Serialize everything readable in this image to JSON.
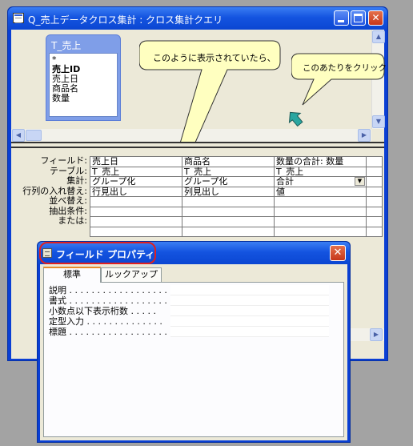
{
  "query_window": {
    "title": "Q_売上データクロス集計 : クロス集計クエリ",
    "table_box": {
      "name": "T_売上",
      "fields": [
        "*",
        "売上ID",
        "売上日",
        "商品名",
        "数量"
      ]
    }
  },
  "grid": {
    "row_labels": [
      "フィールド:",
      "テーブル:",
      "集計:",
      "行列の入れ替え:",
      "並べ替え:",
      "抽出条件:",
      "または:"
    ],
    "columns": [
      {
        "field": "売上日",
        "table": "T_売上",
        "total": "グループ化",
        "crosstab": "行見出し"
      },
      {
        "field": "商品名",
        "table": "T_売上",
        "total": "グループ化",
        "crosstab": "列見出し"
      },
      {
        "field": "数量の合計: 数量",
        "table": "T_売上",
        "total": "合計",
        "crosstab": "値"
      }
    ]
  },
  "callouts": {
    "main": "このように表示されていたら、",
    "click_here": "このあたりをクリック"
  },
  "property_dialog": {
    "title": "フィールド プロパティ",
    "tabs": [
      "標準",
      "ルックアップ"
    ],
    "properties": [
      {
        "label": "説明 . . . . . . . . . . . . . . . . . .",
        "value": ""
      },
      {
        "label": "書式 . . . . . . . . . . . . . . . . . .",
        "value": ""
      },
      {
        "label": "小数点以下表示桁数 . . . . .",
        "value": ""
      },
      {
        "label": "定型入力 . . . . . . . . . . . . . .",
        "value": ""
      },
      {
        "label": "標題 . . . . . . . . . . . . . . . . . .",
        "value": ""
      }
    ]
  },
  "colors": {
    "titlebar": "#0b46d2",
    "client": "#ece9d8",
    "callout": "#ffffc0",
    "cursor_arrow": "#2aa6a0",
    "highlight_ring": "#e02020"
  }
}
